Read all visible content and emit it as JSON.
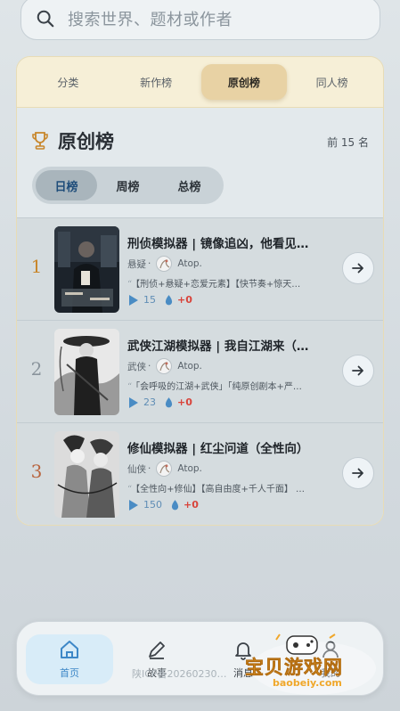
{
  "search": {
    "placeholder": "搜索世界、题材或作者"
  },
  "tabs": [
    {
      "label": "分类"
    },
    {
      "label": "新作榜"
    },
    {
      "label": "原创榜",
      "active": true
    },
    {
      "label": "同人榜"
    }
  ],
  "ranking": {
    "title": "原创榜",
    "count": "前 15 名",
    "periods": [
      {
        "label": "日榜",
        "active": true
      },
      {
        "label": "周榜"
      },
      {
        "label": "总榜"
      }
    ]
  },
  "items": [
    {
      "rank": "1",
      "title": "刑侦模拟器 | 镜像追凶，他看见…",
      "genre": "悬疑",
      "sep": "·",
      "author": "Atop.",
      "tags": "【刑侦+悬疑+恋爱元素】【快节奏+惊天…",
      "plays": "15",
      "heat": "+0",
      "rank_color": "#c8862a"
    },
    {
      "rank": "2",
      "title": "武侠江湖模拟器 | 我自江湖来（…",
      "genre": "武侠",
      "sep": "·",
      "author": "Atop.",
      "tags": "「会呼吸的江湖+武侠」「纯原创剧本+严…",
      "plays": "23",
      "heat": "+0",
      "rank_color": "#8a949c"
    },
    {
      "rank": "3",
      "title": "修仙模拟器 | 红尘问道（全性向）",
      "genre": "仙侠",
      "sep": "·",
      "author": "Atop.",
      "tags": "【全性向+修仙】【高自由度+千人千面】 …",
      "plays": "150",
      "heat": "+0",
      "rank_color": "#b8643e"
    }
  ],
  "nav": [
    {
      "label": "首页",
      "active": true
    },
    {
      "label": "故事"
    },
    {
      "label": "消息"
    },
    {
      "label": "我的"
    }
  ],
  "footer": {
    "icp": "陕ICP备20260230…"
  },
  "watermark": {
    "text": "宝贝游戏网",
    "url": "baobeiy.com"
  },
  "colors": {
    "accent": "#3d87c7",
    "tab_bg": "#f6efd7",
    "tab_active": "#e8d2a4",
    "heat": "#d8443b"
  }
}
